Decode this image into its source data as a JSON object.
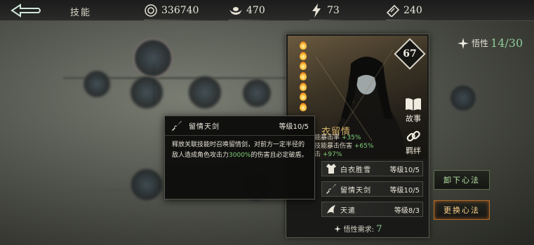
{
  "topbar": {
    "back_icon": "back-arrow-icon",
    "title": "技能",
    "resources": [
      {
        "icon": "coin-icon",
        "value": "336740"
      },
      {
        "icon": "ingot-icon",
        "value": "470"
      },
      {
        "icon": "lightning-icon",
        "value": "73"
      },
      {
        "icon": "ticket-icon",
        "value": "240"
      }
    ]
  },
  "insight": {
    "label": "悟性",
    "value": "14/30"
  },
  "character": {
    "level": "67",
    "name": "衣留情",
    "story_label": "故事",
    "bond_label": "羁绊",
    "stats": [
      {
        "label": "能暴击率",
        "value": "+35%"
      },
      {
        "label": "技能暴击伤害",
        "value": "+65%"
      },
      {
        "label": "击",
        "value": "+97%"
      }
    ],
    "equipment": [
      {
        "icon": "robe-icon",
        "name": "白衣胜雪",
        "level": "等级10/5"
      },
      {
        "icon": "sword-icon",
        "name": "留情天剑",
        "level": "等级10/5"
      },
      {
        "icon": "heaven-icon",
        "name": "天遣",
        "level": "等级8/3"
      }
    ],
    "requirement_label": "悟性需求:",
    "requirement_value": "7"
  },
  "buttons": {
    "unload": "卸下心法",
    "change": "更换心法"
  },
  "tooltip": {
    "icon": "sword-icon",
    "name": "留情天剑",
    "level": "等级10/5",
    "desc_part1": "释放关联技能时召唤留情剑，对前方一定半径的敌人造成角色攻击力",
    "desc_highlight": "3000%",
    "desc_part2": "的伤害且必定破盾。"
  },
  "colors": {
    "accent_green": "#7fd07a",
    "insight_green": "#8fc99a",
    "gold_name": "#d8b46a",
    "change_border": "#b06a2a"
  }
}
